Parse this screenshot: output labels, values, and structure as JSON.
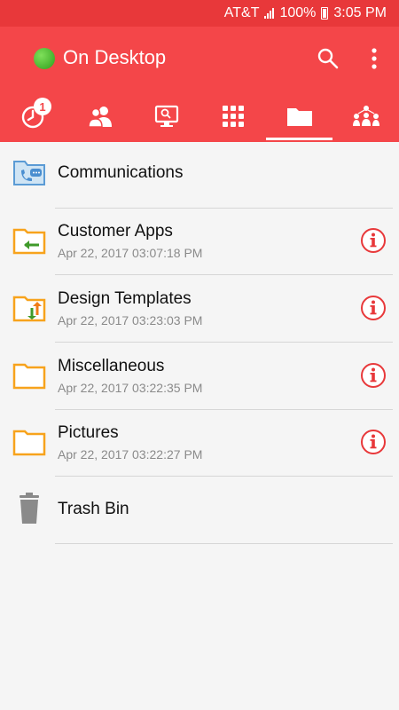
{
  "status_bar": {
    "carrier": "AT&T",
    "battery": "100%",
    "time": "3:05 PM"
  },
  "app_bar": {
    "title": "On Desktop",
    "status_color": "#3fbf2a",
    "accent_color": "#f44649"
  },
  "tabs": [
    {
      "name": "history",
      "icon": "clock-icon",
      "badge": "1"
    },
    {
      "name": "contacts",
      "icon": "people-icon"
    },
    {
      "name": "remote",
      "icon": "monitor-icon"
    },
    {
      "name": "apps",
      "icon": "grid-icon"
    },
    {
      "name": "files",
      "icon": "folder-icon",
      "selected": true
    },
    {
      "name": "groups",
      "icon": "network-icon"
    }
  ],
  "files": [
    {
      "name": "Communications",
      "date": "",
      "icon": "communications-folder-icon"
    },
    {
      "name": "Customer Apps",
      "date": "Apr 22, 2017 03:07:18 PM",
      "icon": "folder-download-icon"
    },
    {
      "name": "Design Templates",
      "date": "Apr 22, 2017 03:23:03 PM",
      "icon": "folder-sync-icon"
    },
    {
      "name": "Miscellaneous",
      "date": "Apr 22, 2017 03:22:35 PM",
      "icon": "folder-icon"
    },
    {
      "name": "Pictures",
      "date": "Apr 22, 2017 03:22:27 PM",
      "icon": "folder-icon"
    },
    {
      "name": "Trash Bin",
      "date": "",
      "icon": "trash-icon"
    }
  ]
}
